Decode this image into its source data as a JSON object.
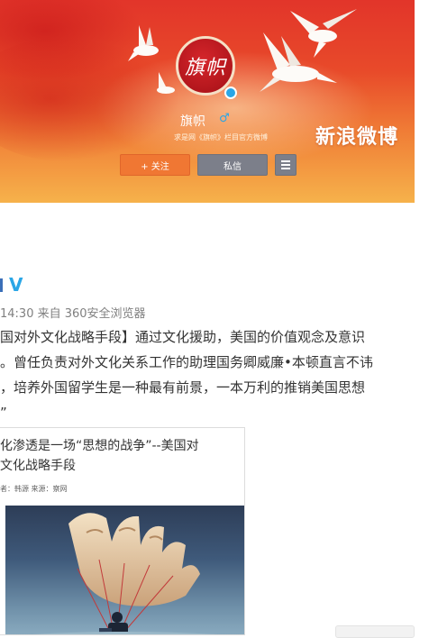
{
  "profile": {
    "avatar_text": "旗帜",
    "name": "旗帜",
    "gender_icon": "♂",
    "description": "求是网《旗帜》栏目官方微博",
    "brand": "新浪微博",
    "follow_label": "+ 关注",
    "message_label": "私信",
    "menu_icon": "menu-icon"
  },
  "post": {
    "author_suffix": "V",
    "meta": "14:30 来自 360安全浏览器",
    "lines": [
      "国对外文化战略手段】通过文化援助，美国的价值观念及意识",
      "。曾任负责对外文化关系工作的助理国务卿威廉•本顿直言不讳",
      "，培养外国留学生是一种最有前景，一本万利的推销美国思想",
      "”"
    ]
  },
  "card": {
    "title_lines": [
      "化渗透是一场“思想的战争”--美国对",
      "文化战略手段"
    ],
    "source": "者：韩源 来源：察网"
  },
  "colors": {
    "banner_red": "#e2352a",
    "banner_orange": "#f6b24b",
    "follow_button": "#f07733",
    "secondary_button": "#7c7f8a",
    "verified_blue": "#2aa6e6"
  }
}
